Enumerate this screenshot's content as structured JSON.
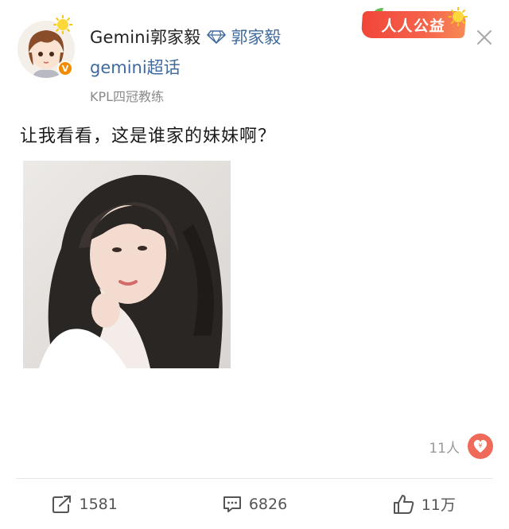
{
  "post": {
    "author": {
      "name": "Gemini郭家毅",
      "linked_name": "郭家毅",
      "topic": "gemini超话",
      "description": "KPL四冠教练",
      "verified_mark": "V"
    },
    "promo_badge": "人人公益",
    "text": "让我看看，这是谁家的妹妹啊？",
    "reward": {
      "count": "11人"
    }
  },
  "actions": {
    "repost_count": "1581",
    "comment_count": "6826",
    "like_count": "11万"
  },
  "colors": {
    "link": "#3f6a9e",
    "promo": "#f0463a",
    "verified": "#f28b00",
    "reward": "#f06a5a"
  }
}
